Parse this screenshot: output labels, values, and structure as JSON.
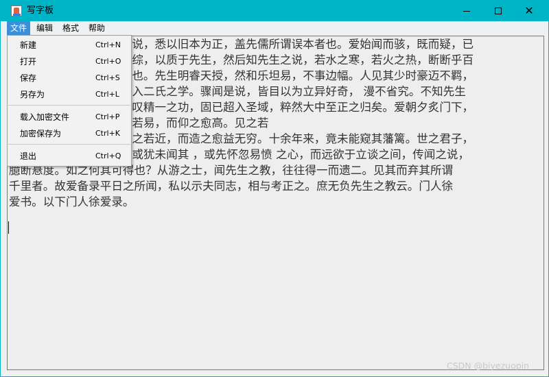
{
  "window": {
    "title": "写字板",
    "icon": "notepad-icon",
    "controls": {
      "minimize": "minimize-icon",
      "maximize": "maximize-icon",
      "close": "✕"
    },
    "title_bar_color": "#00b4c8"
  },
  "menubar": {
    "items": [
      {
        "label": "文件",
        "active": true
      },
      {
        "label": "编辑"
      },
      {
        "label": "格式"
      },
      {
        "label": "帮助"
      }
    ],
    "active_color": "#3d8fd9"
  },
  "file_menu": {
    "items": [
      {
        "label": "新建",
        "shortcut": "Ctrl+N"
      },
      {
        "label": "打开",
        "shortcut": "Ctrl+O"
      },
      {
        "label": "保存",
        "shortcut": "Ctrl+S"
      },
      {
        "label": "另存为",
        "shortcut": "Ctrl+L"
      },
      {
        "label": "载入加密文件",
        "shortcut": "Ctrl+P"
      },
      {
        "label": "加密保存为",
        "shortcut": "Ctrl+K"
      },
      {
        "label": "退出",
        "shortcut": "Ctrl+Q"
      }
    ]
  },
  "editor": {
    "lines": [
      "                                  说，悉以旧本为正，盖先儒所谓误本者也。爱始闻而骇，既而疑，已",
      "                                  综，以质于先生，然后知先生之说，若水之寒，若火之热，断断乎百",
      "                                  也。先生明睿天授，然和乐坦易，不事边幅。人见其少时豪迈不羁，",
      "                                  入二氏之学。骤闻是说，皆目以为立异好奇， 漫不省究。不知先生",
      "                                  叹精一之功，固已超入圣域，粹然大中至正之归矣。爱朝夕炙门下，",
      "                                  若易，而仰之愈高。见之若",
      "                                  之若近，而造之愈益无穷。十余年来，竟未能窥其藩篱。世之君子，",
      "                                  或犹未闻其 ，或先怀忽易愤 之心，而远欲于立谈之间，传闻之说，",
      "臆断悬度。如之何其可得也？从游之士，闻先生之教，往往得一而遗二。见其而弃其所谓",
      "千里者。故爱备录平日之所闻，私以示夫同志，相与考正之。庶无负先生之教云。门人徐",
      "爱书。以下门人徐爱录。"
    ]
  },
  "watermark": "CSDN @biyezuopin"
}
